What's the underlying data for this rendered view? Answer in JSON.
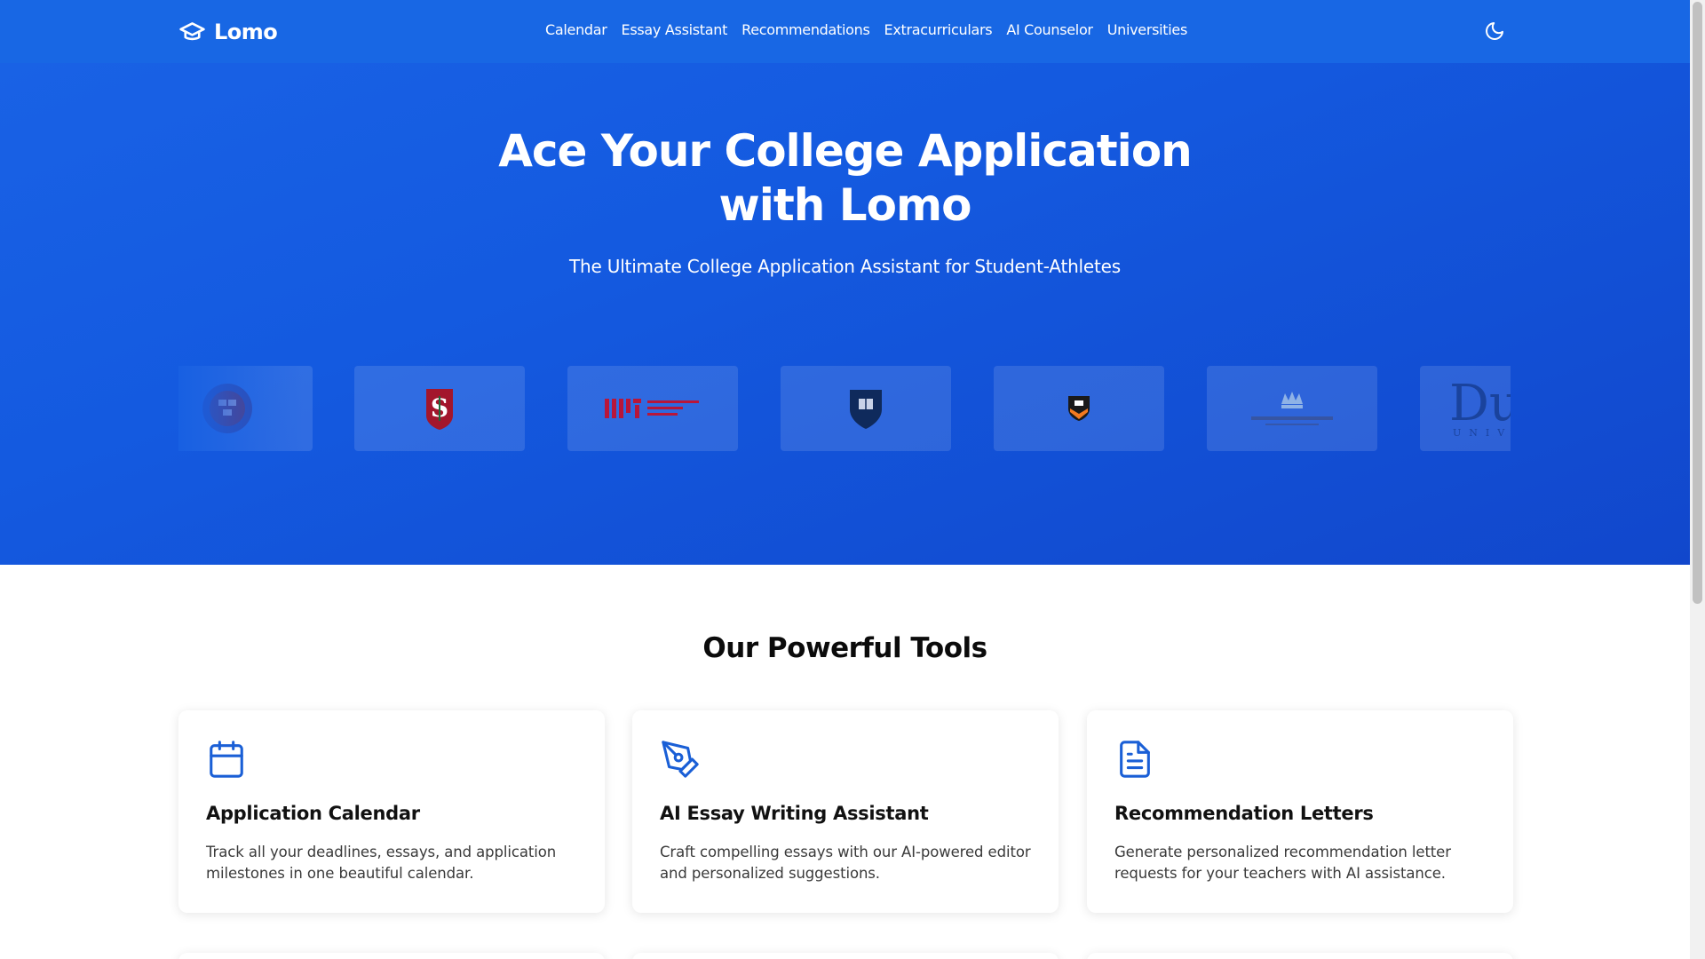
{
  "brand": {
    "name": "Lomo",
    "icon": "graduation-cap-icon"
  },
  "nav": {
    "links": [
      "Calendar",
      "Essay Assistant",
      "Recommendations",
      "Extracurriculars",
      "AI Counselor",
      "Universities"
    ],
    "theme_toggle_icon": "moon-icon"
  },
  "hero": {
    "title_line1": "Ace Your College Application",
    "title_line2": "with Lomo",
    "subtitle": "The Ultimate College Application Assistant for Student-Athletes"
  },
  "university_logos": [
    "harvard-logo",
    "stanford-logo",
    "mit-logo",
    "yale-logo",
    "princeton-logo",
    "columbia-logo",
    "duke-logo"
  ],
  "tools": {
    "title": "Our Powerful Tools",
    "cards": [
      {
        "icon": "calendar-icon",
        "title": "Application Calendar",
        "description": "Track all your deadlines, essays, and application milestones in one beautiful calendar."
      },
      {
        "icon": "pen-tool-icon",
        "title": "AI Essay Writing Assistant",
        "description": "Craft compelling essays with our AI-powered editor and personalized suggestions."
      },
      {
        "icon": "document-icon",
        "title": "Recommendation Letters",
        "description": "Generate personalized recommendation letter requests for your teachers with AI assistance."
      }
    ]
  },
  "colors": {
    "primary": "#1867e4",
    "hero_dark": "#1147cc",
    "icon_blue": "#1a5fd6"
  }
}
